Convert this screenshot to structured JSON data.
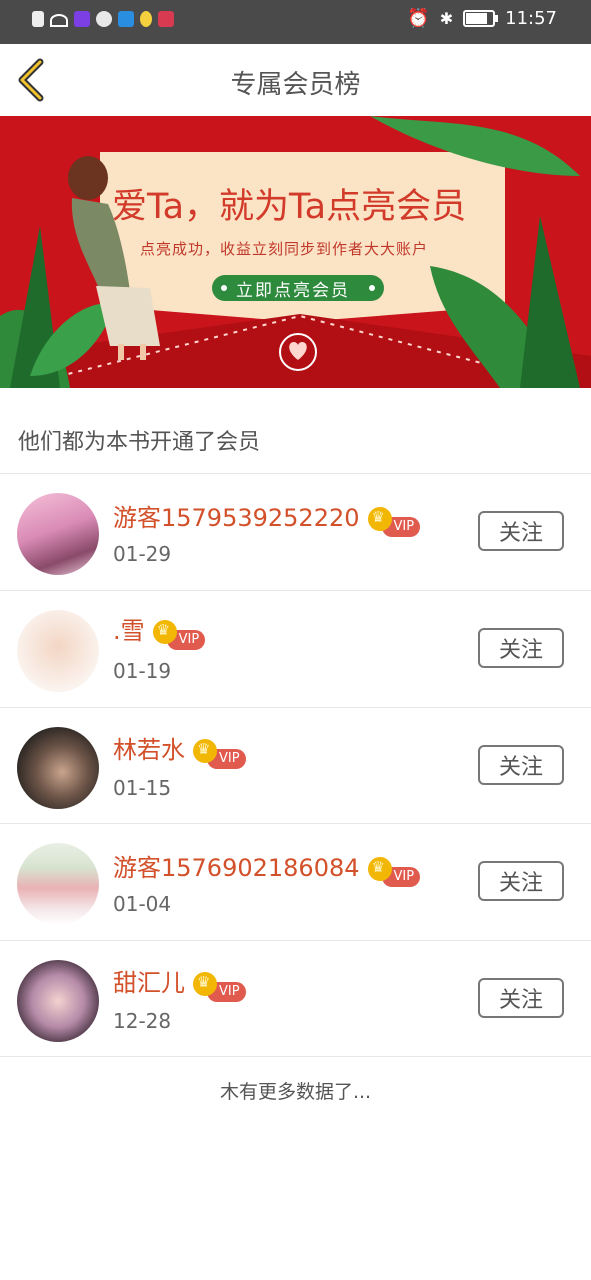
{
  "status_bar": {
    "time": "11:57"
  },
  "header": {
    "title": "专属会员榜",
    "back_icon": "chevron-left-icon"
  },
  "banner": {
    "headline": "爱Ta，就为Ta点亮会员",
    "subline": "点亮成功，收益立刻同步到作者大大账户",
    "cta": "立即点亮会员"
  },
  "section": {
    "title": "他们都为本书开通了会员"
  },
  "members": [
    {
      "name": "游客1579539252220",
      "date": "01-29",
      "badge": "VIP",
      "follow": "关注"
    },
    {
      "name": ".雪",
      "date": "01-19",
      "badge": "VIP",
      "follow": "关注"
    },
    {
      "name": "林若水",
      "date": "01-15",
      "badge": "VIP",
      "follow": "关注"
    },
    {
      "name": "游客1576902186084",
      "date": "01-04",
      "badge": "VIP",
      "follow": "关注"
    },
    {
      "name": "甜汇儿",
      "date": "12-28",
      "badge": "VIP",
      "follow": "关注"
    }
  ],
  "footer": {
    "text": "木有更多数据了..."
  },
  "colors": {
    "accent": "#f2b705",
    "name": "#d2502a",
    "banner_bg": "#c8141a",
    "vip_tag": "#e05a4e"
  }
}
